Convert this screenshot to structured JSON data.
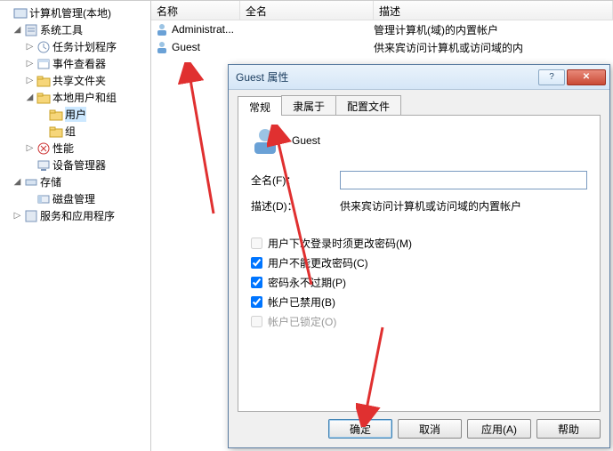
{
  "tree": {
    "root": "计算机管理(本地)",
    "n1": "系统工具",
    "n1a": "任务计划程序",
    "n1b": "事件查看器",
    "n1c": "共享文件夹",
    "n1d": "本地用户和组",
    "n1d1": "用户",
    "n1d2": "组",
    "n1e": "性能",
    "n1f": "设备管理器",
    "n2": "存储",
    "n2a": "磁盘管理",
    "n3": "服务和应用程序"
  },
  "list": {
    "col_name": "名称",
    "col_full": "全名",
    "col_desc": "描述",
    "rows": [
      {
        "name": "Administrat...",
        "full": "",
        "desc": "管理计算机(域)的内置帐户"
      },
      {
        "name": "Guest",
        "full": "",
        "desc": "供来宾访问计算机或访问域的内"
      }
    ]
  },
  "dialog": {
    "title": "Guest 属性",
    "tabs": {
      "t1": "常规",
      "t2": "隶属于",
      "t3": "配置文件"
    },
    "username": "Guest",
    "full_label": "全名(F)：",
    "full_value": "",
    "desc_label": "描述(D)：",
    "desc_value": "供来宾访问计算机或访问域的内置帐户",
    "chk1": "用户下次登录时须更改密码(M)",
    "chk2": "用户不能更改密码(C)",
    "chk3": "密码永不过期(P)",
    "chk4": "帐户已禁用(B)",
    "chk5": "帐户已锁定(O)",
    "btn_ok": "确定",
    "btn_cancel": "取消",
    "btn_apply": "应用(A)",
    "btn_help": "帮助"
  }
}
